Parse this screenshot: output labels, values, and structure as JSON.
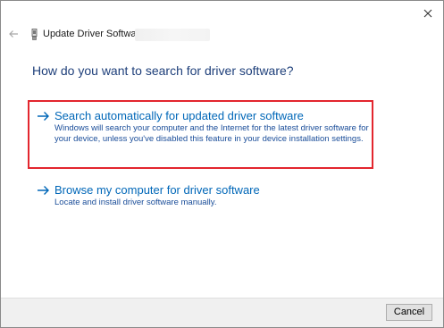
{
  "window": {
    "title": "Update Driver Software"
  },
  "icons": {
    "back": "back-arrow-icon",
    "device": "device-icon",
    "close": "close-icon",
    "option_arrow": "right-arrow-icon"
  },
  "colors": {
    "heading": "#1e3f7a",
    "link": "#0067b8",
    "description": "#1a4d99",
    "highlight_border": "#e3262e",
    "footer_bg": "#f0f0f0"
  },
  "main": {
    "heading": "How do you want to search for driver software?",
    "options": [
      {
        "title": "Search automatically for updated driver software",
        "description": "Windows will search your computer and the Internet for the latest driver software for your device, unless you've disabled this feature in your device installation settings.",
        "highlighted": true
      },
      {
        "title": "Browse my computer for driver software",
        "description": "Locate and install driver software manually.",
        "highlighted": false
      }
    ]
  },
  "footer": {
    "cancel_label": "Cancel"
  }
}
